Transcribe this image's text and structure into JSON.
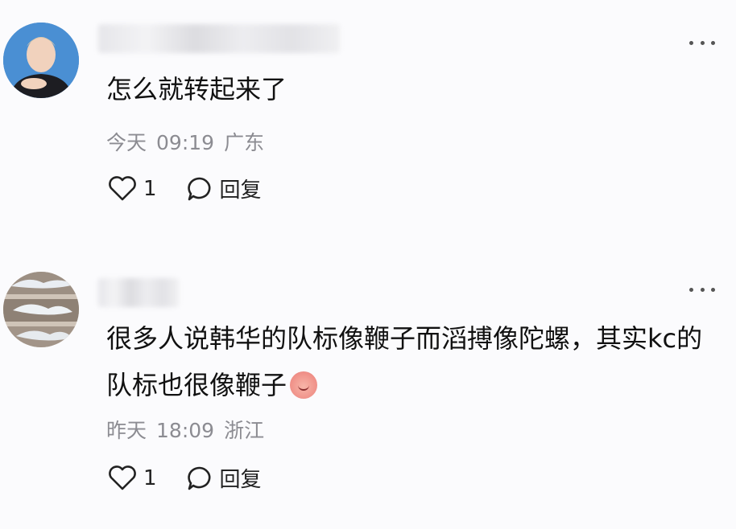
{
  "comments": [
    {
      "content": "怎么就转起来了",
      "date": "今天",
      "time": "09:19",
      "location": "广东",
      "like_count": "1",
      "reply_label": "回复"
    },
    {
      "content": "很多人说韩华的队标像鞭子而滔搏像陀螺，其实kc的队标也很像鞭子",
      "date": "昨天",
      "time": "18:09",
      "location": "浙江",
      "like_count": "1",
      "reply_label": "回复"
    }
  ],
  "icons": {
    "like": "heart-outline-icon",
    "reply": "speech-bubble-icon",
    "more": "more-dots-icon"
  },
  "colors": {
    "background": "#fbfbfd",
    "text": "#111111",
    "meta": "#8c8c92"
  }
}
